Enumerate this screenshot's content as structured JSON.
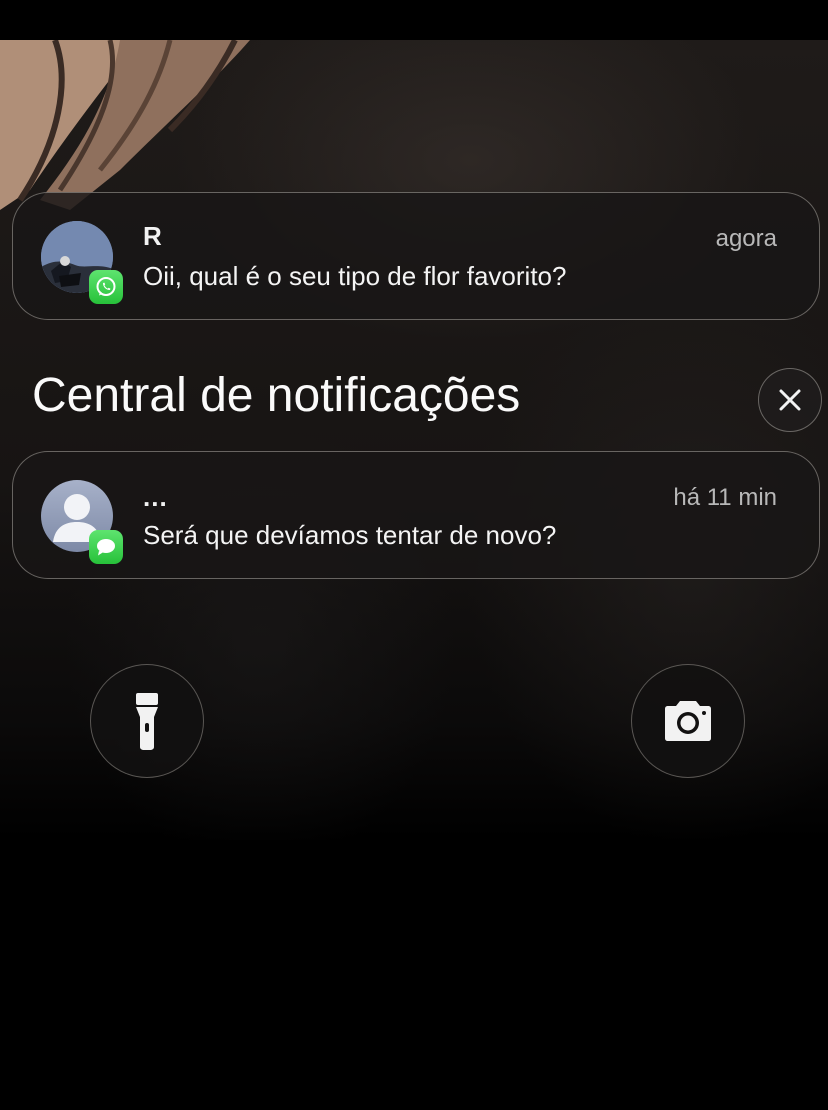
{
  "notifications": [
    {
      "sender": "R",
      "time": "agora",
      "message": "Oii, qual é o seu tipo de flor favorito?",
      "avatar_icon": "profile-photo",
      "app_icon": "whatsapp-icon",
      "app_color": "#25D366"
    }
  ],
  "notification_center": {
    "title": "Central de notificações",
    "close_icon": "close-icon",
    "items": [
      {
        "sender": "...",
        "time": "há 11 min",
        "message": "Será que devíamos tentar de novo?",
        "avatar_icon": "contact-placeholder-icon",
        "app_icon": "messages-icon",
        "app_color": "#34C759"
      }
    ]
  },
  "quick_actions": {
    "left_icon": "flashlight-icon",
    "right_icon": "camera-icon"
  }
}
